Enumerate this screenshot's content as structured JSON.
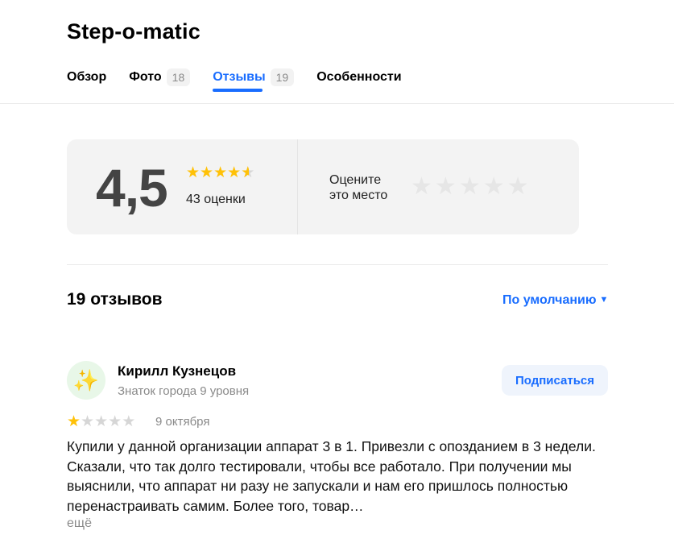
{
  "header": {
    "title": "Step-o-matic",
    "tabs": [
      {
        "label": "Обзор",
        "count": ""
      },
      {
        "label": "Фото",
        "count": "18"
      },
      {
        "label": "Отзывы",
        "count": "19"
      },
      {
        "label": "Особенности",
        "count": ""
      }
    ],
    "active_tab": "Отзывы"
  },
  "rating_summary": {
    "value": "4,5",
    "stars_filled": 4.5,
    "count_text": "43 оценки",
    "rate_prompt_line1": "Оцените",
    "rate_prompt_line2": "это место"
  },
  "reviews": {
    "count_title": "19 отзывов",
    "sort_label": "По умолчанию",
    "items": [
      {
        "avatar_emoji": "✨",
        "author": "Кирилл Кузнецов",
        "level": "Знаток города 9 уровня",
        "subscribe_label": "Подписаться",
        "stars": 1,
        "date": "9 октября",
        "text": "Купили у данной организации аппарат 3 в 1. Привезли с опозданием в 3 недели. Сказали, что так долго тестировали, чтобы все работало. При получении мы выяснили, что аппарат ни разу не запускали и нам его пришлось полностью перенастраивать самим. Более того, товар…",
        "more_label": "ещё"
      }
    ]
  },
  "colors": {
    "accent": "#196dff",
    "star_gold": "#ffc107",
    "star_gray": "#d6d6d6",
    "card_bg": "#f3f3f3"
  }
}
